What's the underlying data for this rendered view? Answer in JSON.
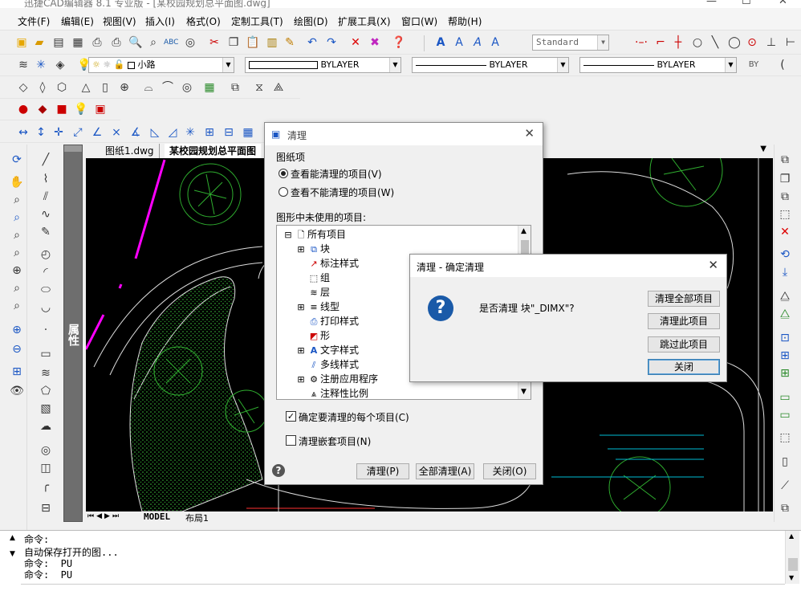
{
  "app": {
    "title": "迅捷CAD编辑器 8.1 专业版 - [某校园规划总平面图.dwg]"
  },
  "menu": [
    "文件(F)",
    "编辑(E)",
    "视图(V)",
    "插入(I)",
    "格式(O)",
    "定制工具(T)",
    "绘图(D)",
    "扩展工具(X)",
    "窗口(W)",
    "帮助(H)"
  ],
  "toolbar": {
    "text_style": "Standard",
    "layer": "小路",
    "color": "BYLAYER",
    "linetype": "BYLAYER",
    "lineweight": "BYLAYER"
  },
  "doc_tabs": [
    "图纸1.dwg",
    "某校园规划总平面图"
  ],
  "side_panel_label": "属性",
  "layout_tabs": [
    "MODEL",
    "布局1"
  ],
  "command_lines": [
    "命令:",
    "自动保存打开的图...",
    "命令:  PU",
    "命令:  PU"
  ],
  "purge_dialog": {
    "title": "清理",
    "group_label": "图纸项",
    "radio_can": "查看能清理的项目(V)",
    "radio_cannot": "查看不能清理的项目(W)",
    "unused_label": "图形中未使用的项目:",
    "tree": [
      "所有项目",
      "块",
      "标注样式",
      "组",
      "层",
      "线型",
      "打印样式",
      "形",
      "文字样式",
      "多线样式",
      "注册应用程序",
      "注释性比例"
    ],
    "confirm_each": "确定要清理的每个项目(C)",
    "purge_nested": "清理嵌套项目(N)",
    "btn_purge": "清理(P)",
    "btn_purge_all": "全部清理(A)",
    "btn_close": "关闭(O)",
    "help": "?"
  },
  "confirm_dialog": {
    "title": "清理 - 确定清理",
    "message": "是否清理 块\"_DIMX\"?",
    "icon": "?",
    "btn_purge_all": "清理全部项目",
    "btn_purge_this": "清理此项目",
    "btn_skip": "跳过此项目",
    "btn_close": "关闭"
  },
  "colors": {
    "canvas": "#000000",
    "tree_green": "#2fae2f",
    "magenta": "#ff00ff",
    "cyan": "#00bcd4"
  }
}
